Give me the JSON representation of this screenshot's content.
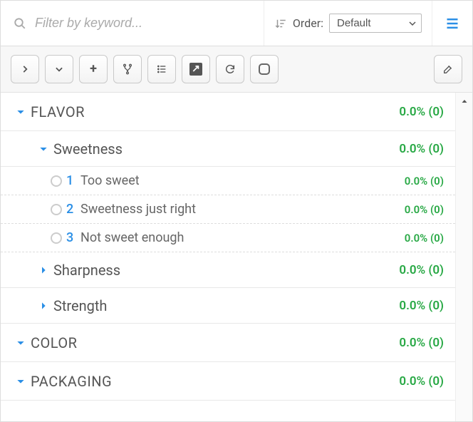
{
  "topbar": {
    "filter_placeholder": "Filter by keyword...",
    "order_label": "Order:",
    "order_select_value": "Default",
    "order_options": [
      "Default"
    ]
  },
  "toolbar": {
    "collapse_right": "Collapse",
    "collapse_down": "Expand",
    "add": "+",
    "branch": "Branch",
    "list": "List",
    "popout": "Open",
    "refresh": "Refresh",
    "uncheck": "Uncheck",
    "edit": "Edit"
  },
  "stats_default": {
    "pct": "0.0%",
    "count": "(0)"
  },
  "tree": [
    {
      "id": "flavor",
      "label": "Flavor",
      "expanded": true,
      "stat": "0.0% (0)",
      "children": [
        {
          "id": "sweetness",
          "label": "Sweetness",
          "expanded": true,
          "stat": "0.0% (0)",
          "items": [
            {
              "n": "1",
              "label": "Too sweet",
              "stat": "0.0% (0)"
            },
            {
              "n": "2",
              "label": "Sweetness just right",
              "stat": "0.0% (0)"
            },
            {
              "n": "3",
              "label": "Not sweet enough",
              "stat": "0.0% (0)"
            }
          ]
        },
        {
          "id": "sharpness",
          "label": "Sharpness",
          "expanded": false,
          "stat": "0.0% (0)"
        },
        {
          "id": "strength",
          "label": "Strength",
          "expanded": false,
          "stat": "0.0% (0)"
        }
      ]
    },
    {
      "id": "color",
      "label": "Color",
      "expanded": true,
      "stat": "0.0% (0)"
    },
    {
      "id": "packaging",
      "label": "Packaging",
      "expanded": true,
      "stat": "0.0% (0)"
    }
  ]
}
